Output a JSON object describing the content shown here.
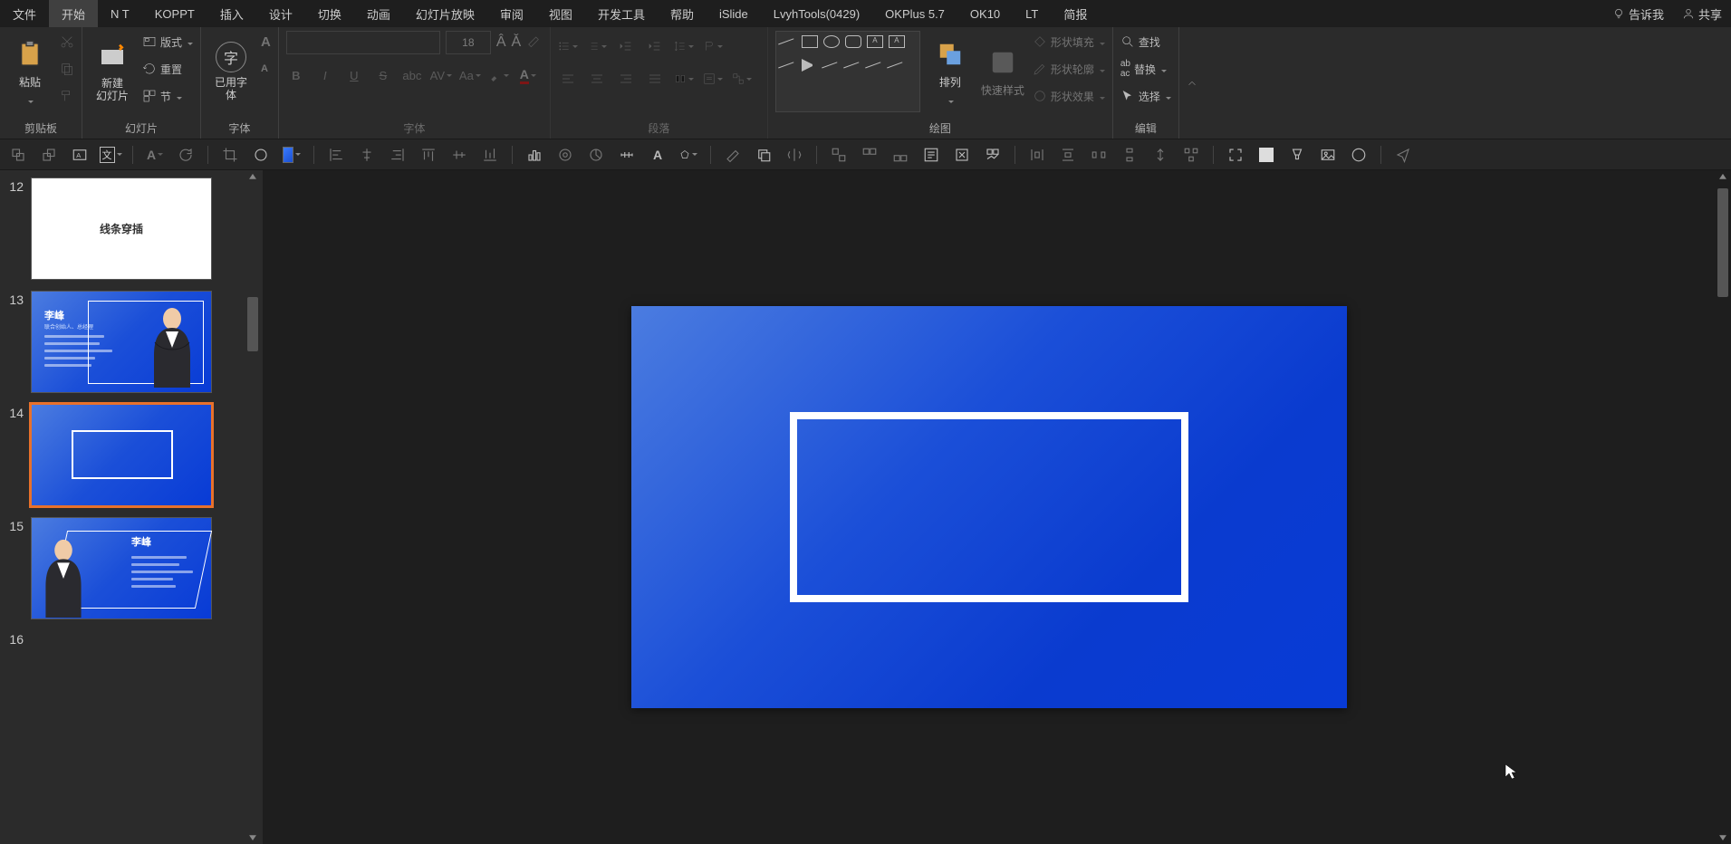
{
  "menu": {
    "file": "文件",
    "home": "开始",
    "nt": "N T",
    "koppt": "KOPPT",
    "insert": "插入",
    "design": "设计",
    "transition": "切换",
    "animation": "动画",
    "slideshow": "幻灯片放映",
    "review": "审阅",
    "view": "视图",
    "developer": "开发工具",
    "help": "帮助",
    "islide": "iSlide",
    "lvyh": "LvyhTools(0429)",
    "okplus": "OKPlus 5.7",
    "ok10": "OK10",
    "lt": "LT",
    "briefing": "简报",
    "tellme": "告诉我",
    "share": "共享"
  },
  "ribbon": {
    "clipboard": {
      "label": "剪贴板",
      "paste": "粘贴"
    },
    "slides": {
      "label": "幻灯片",
      "new": "新建\n幻灯片",
      "layout": "版式",
      "reset": "重置",
      "section": "节"
    },
    "usedfont": {
      "label": "字体",
      "btn": "已用字\n体"
    },
    "font": {
      "label": "字体",
      "size": "18"
    },
    "paragraph": {
      "label": "段落"
    },
    "drawing": {
      "label": "绘图",
      "arrange": "排列",
      "quickstyle": "快速样式",
      "shapefill": "形状填充",
      "shapeoutline": "形状轮廓",
      "shapeeffects": "形状效果"
    },
    "editing": {
      "label": "编辑",
      "find": "查找",
      "replace": "替换",
      "select": "选择"
    }
  },
  "thumbs": {
    "n12": "12",
    "n13": "13",
    "n14": "14",
    "n15": "15",
    "n16": "16",
    "slide12_text": "线条穿插",
    "name": "李峰",
    "subtitle": "联合创始人、总经理"
  },
  "colors": {
    "accent": "#e8712b",
    "slide_blue_start": "#4b7ce0",
    "slide_blue_end": "#083bd6"
  }
}
